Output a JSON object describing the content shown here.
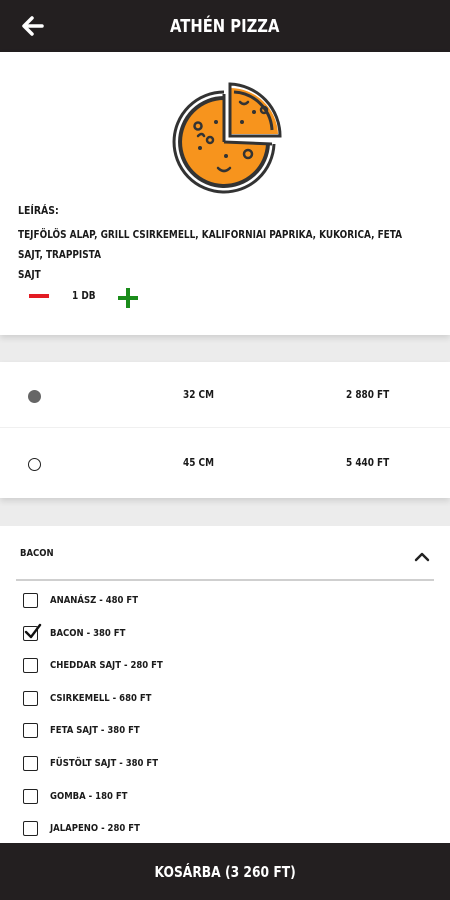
{
  "header": {
    "title": "ATHÉN PIZZA",
    "back_icon": "arrow-left-icon"
  },
  "product": {
    "image_icon": "pizza-icon",
    "description_label": "LEÍRÁS:",
    "description_line1": "TEJFÖLÖS ALAP, GRILL CSIRKEMELL, KALIFORNIAI PAPRIKA, KUKORICA, FETA SAJT, TRAPPISTA",
    "description_line2": "SAJT",
    "quantity_label": "1 DB",
    "minus_icon": "minus-icon",
    "plus_icon": "plus-icon",
    "colors": {
      "minus": "#e31b23",
      "plus": "#1a8c1a",
      "pizza": "#f7941d"
    }
  },
  "sizes": [
    {
      "size": "32 CM",
      "price": "2 880 FT",
      "selected": true
    },
    {
      "size": "45 CM",
      "price": "5 440 FT",
      "selected": false
    }
  ],
  "extras": {
    "section_title": "BACON",
    "chevron_icon": "chevron-up-icon",
    "options": [
      {
        "label": "ANANÁSZ - 480 FT",
        "checked": false
      },
      {
        "label": "BACON - 380 FT",
        "checked": true
      },
      {
        "label": "CHEDDAR SAJT - 280 FT",
        "checked": false
      },
      {
        "label": "CSIRKEMELL - 680 FT",
        "checked": false
      },
      {
        "label": "FETA SAJT - 380 FT",
        "checked": false
      },
      {
        "label": "FÜSTÖLT SAJT - 380 FT",
        "checked": false
      },
      {
        "label": "GOMBA - 180 FT",
        "checked": false
      },
      {
        "label": "JALAPENO - 280 FT",
        "checked": false
      }
    ]
  },
  "footer": {
    "cart_label": "KOSÁRBA (3 260 FT)"
  },
  "theme": {
    "bar_color": "#231f20",
    "background": "#ececec"
  }
}
